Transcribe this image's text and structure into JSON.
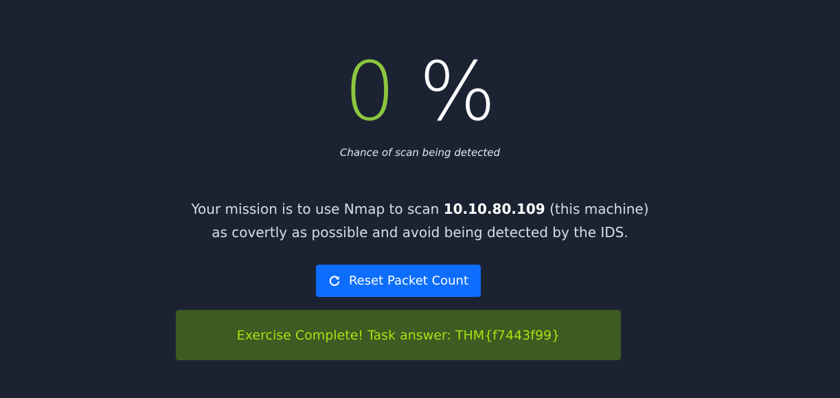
{
  "detection": {
    "value": "0",
    "unit": "%",
    "caption": "Chance of scan being detected",
    "value_color": "#8cc63f"
  },
  "mission": {
    "line1_prefix": "Your mission is to use Nmap to scan ",
    "target_ip": "10.10.80.109",
    "line1_suffix": " (this machine)",
    "line2": "as covertly as possible and avoid being detected by the IDS."
  },
  "reset_button": {
    "icon": "refresh-icon",
    "label": "Reset Packet Count",
    "color": "#0d6efd"
  },
  "alert": {
    "text": "Exercise Complete! Task answer: THM{f7443f99}",
    "background": "#3d5b22",
    "text_color": "#a4e512"
  }
}
